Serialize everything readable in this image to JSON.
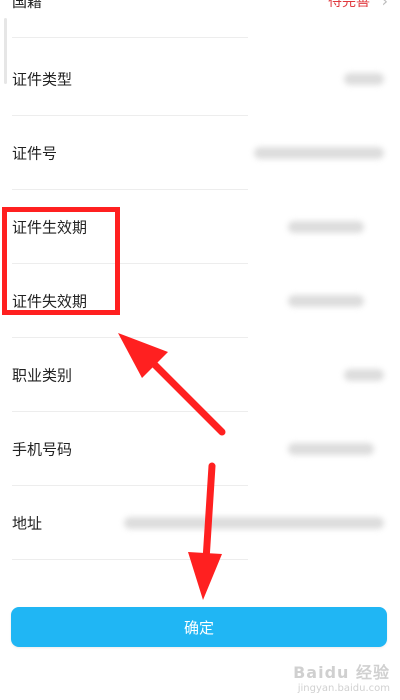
{
  "form": {
    "rows": [
      {
        "label": "国籍",
        "status": "待完善"
      },
      {
        "label": "证件类型"
      },
      {
        "label": "证件号"
      },
      {
        "label": "证件生效期"
      },
      {
        "label": "证件失效期"
      },
      {
        "label": "职业类别"
      },
      {
        "label": "手机号码"
      },
      {
        "label": "地址"
      }
    ]
  },
  "confirm_label": "确定",
  "watermark": {
    "main": "Baidu 经验",
    "sub": "jingyan.baidu.com"
  },
  "colors": {
    "accent": "#20b6f4",
    "status": "#e0393e",
    "annotation": "#ff2020"
  },
  "icons": {
    "chevron": "chevron-right-icon"
  }
}
